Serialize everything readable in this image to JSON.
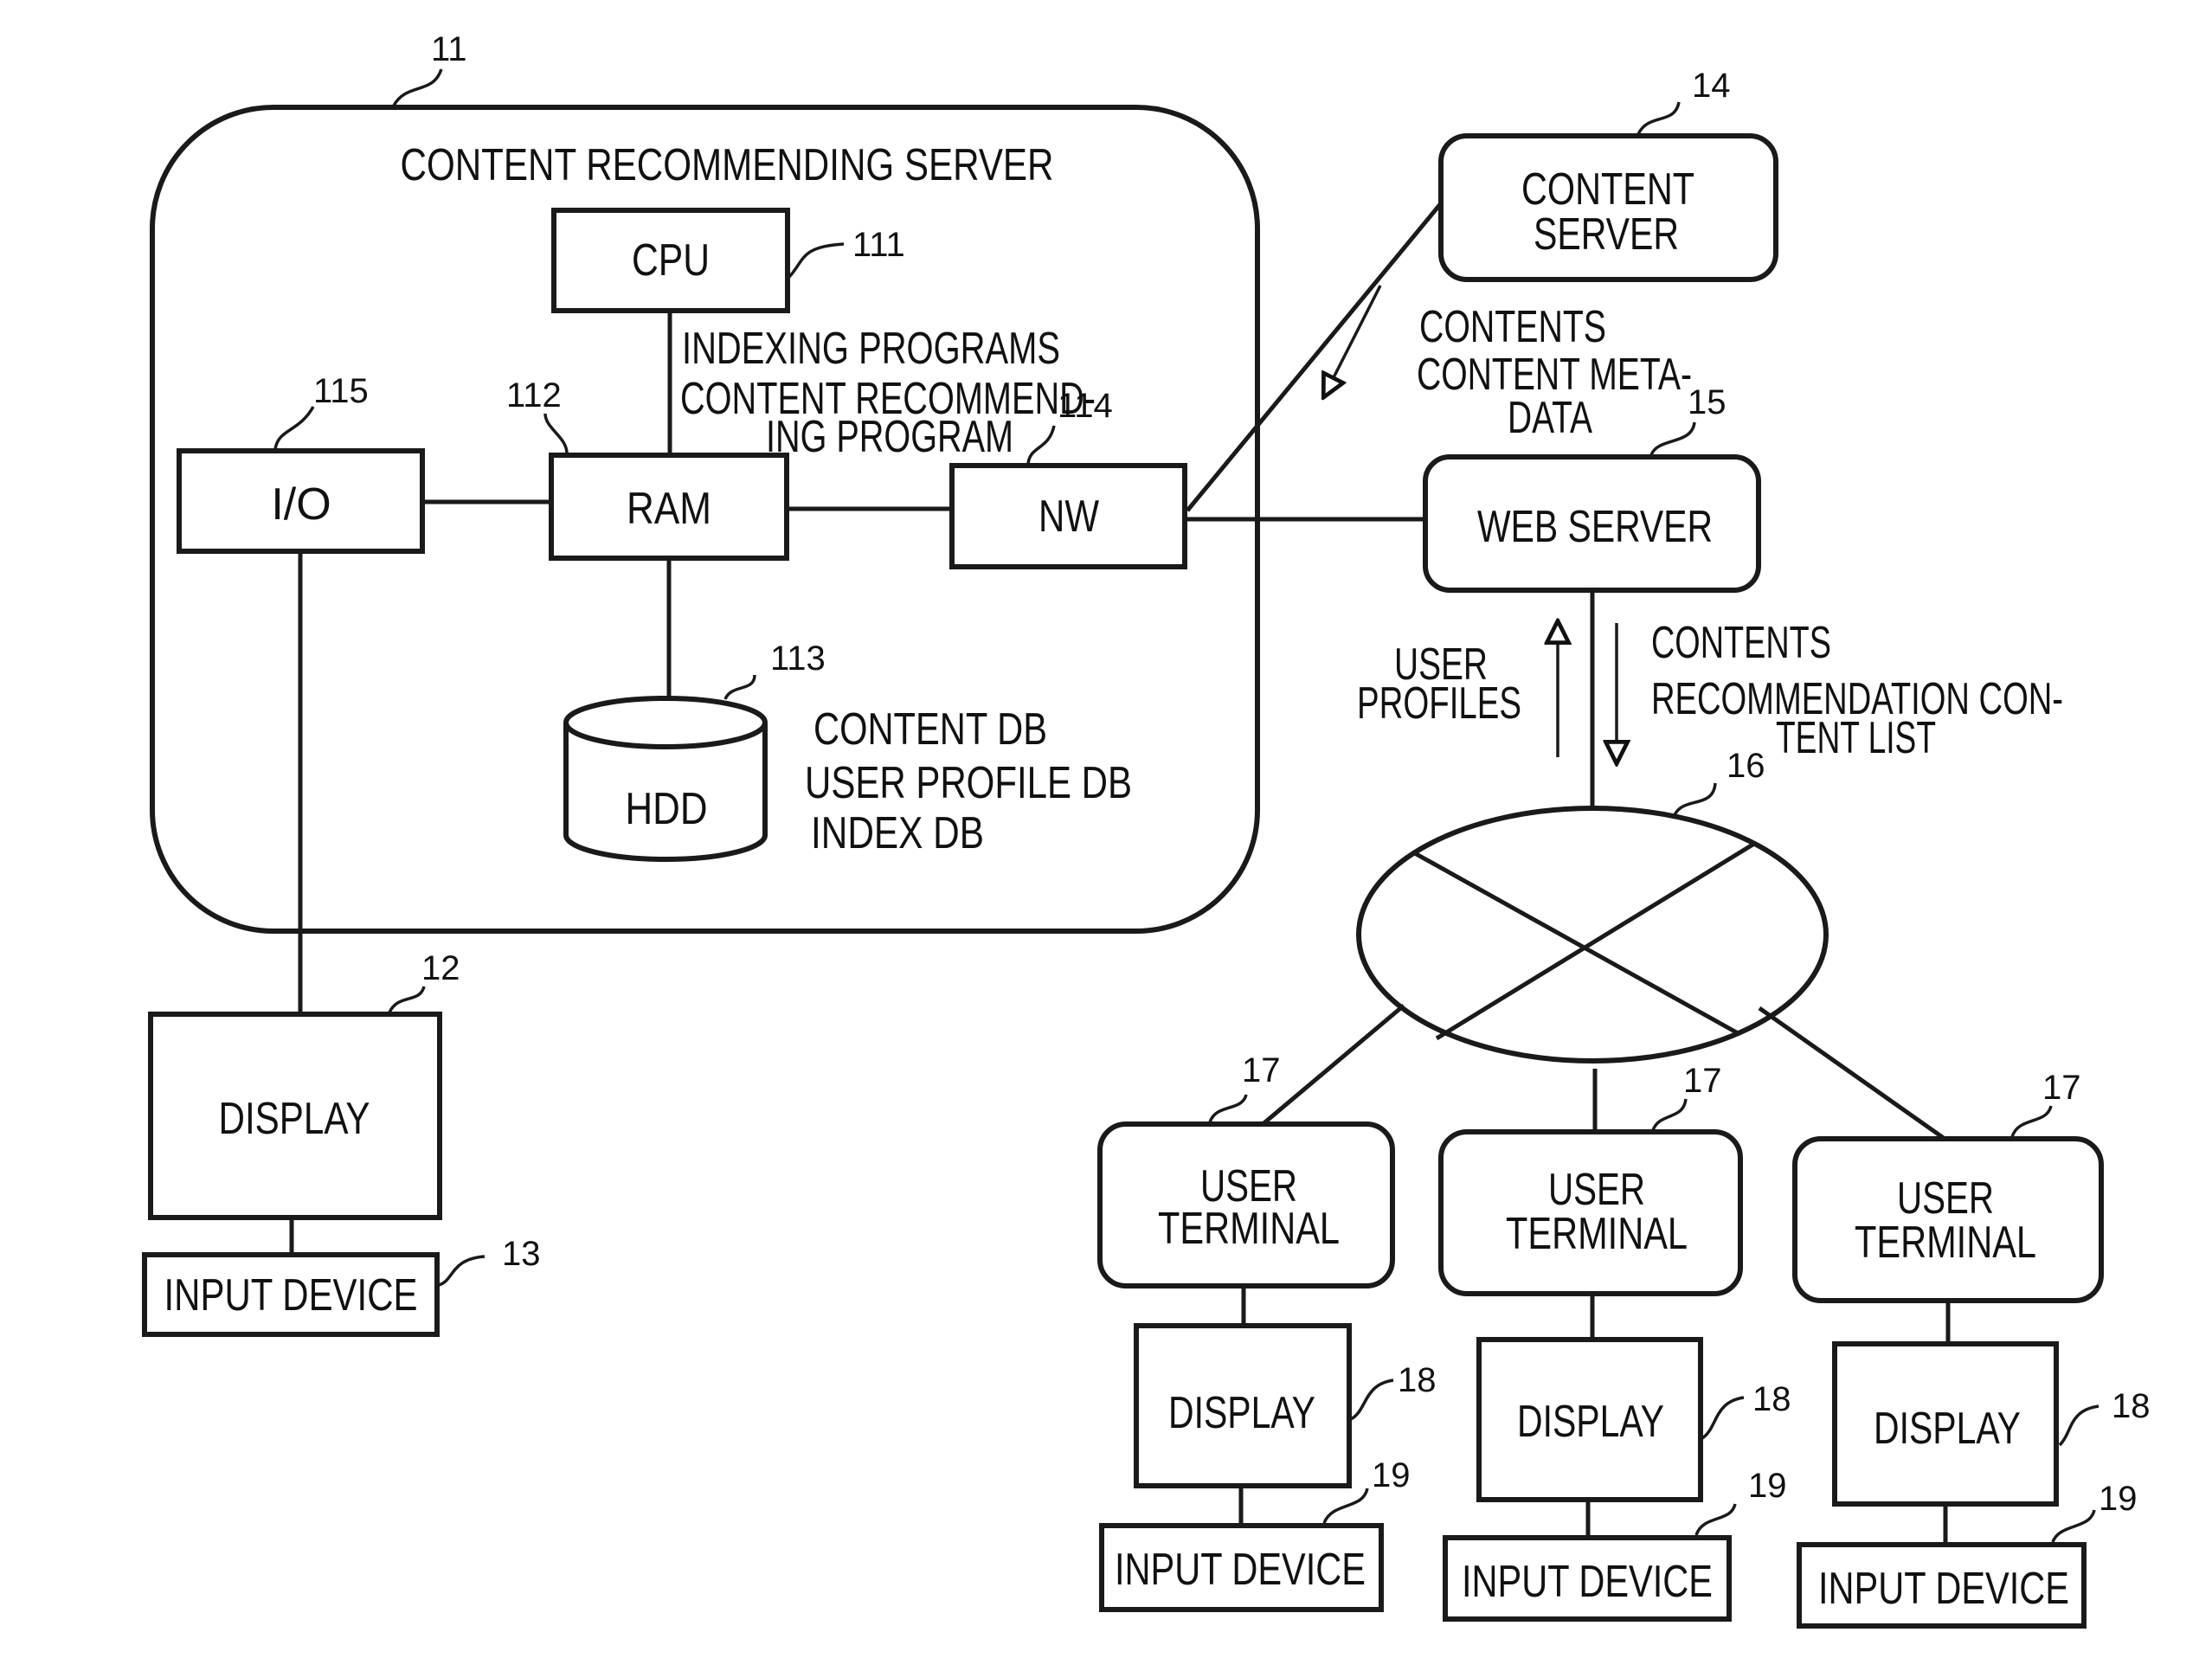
{
  "diagram": {
    "server": {
      "ref": "11",
      "title": "CONTENT RECOMMENDING SERVER",
      "cpu": {
        "label": "CPU",
        "ref": "111"
      },
      "ram": {
        "label": "RAM",
        "ref": "112"
      },
      "hdd": {
        "label": "HDD",
        "ref": "113"
      },
      "nw": {
        "label": "NW",
        "ref": "114"
      },
      "io": {
        "label": "I/O",
        "ref": "115"
      },
      "programs": [
        "INDEXING PROGRAMS",
        "CONTENT RECOMMEND-",
        "ING PROGRAM"
      ],
      "databases": [
        "CONTENT DB",
        "USER PROFILE DB",
        "INDEX DB"
      ]
    },
    "server_display": {
      "label": "DISPLAY",
      "ref": "12"
    },
    "server_input": {
      "label": "INPUT DEVICE",
      "ref": "13"
    },
    "content_server": {
      "label_lines": [
        "CONTENT",
        "SERVER"
      ],
      "ref": "14"
    },
    "content_flow": [
      "CONTENTS",
      "CONTENT META-",
      "DATA"
    ],
    "web_server": {
      "label": "WEB SERVER",
      "ref": "15"
    },
    "upstream_flow": [
      "USER",
      "PROFILES"
    ],
    "downstream_flow": [
      "CONTENTS",
      "RECOMMENDATION CON-",
      "TENT LIST"
    ],
    "network": {
      "ref": "16"
    },
    "terminals": [
      {
        "label_lines": [
          "USER",
          "TERMINAL"
        ],
        "ref": "17",
        "display": "DISPLAY",
        "display_ref": "18",
        "input": "INPUT DEVICE",
        "input_ref": "19"
      },
      {
        "label_lines": [
          "USER",
          "TERMINAL"
        ],
        "ref": "17",
        "display": "DISPLAY",
        "display_ref": "18",
        "input": "INPUT DEVICE",
        "input_ref": "19"
      },
      {
        "label_lines": [
          "USER",
          "TERMINAL"
        ],
        "ref": "17",
        "display": "DISPLAY",
        "display_ref": "18",
        "input": "INPUT DEVICE",
        "input_ref": "19"
      }
    ]
  }
}
